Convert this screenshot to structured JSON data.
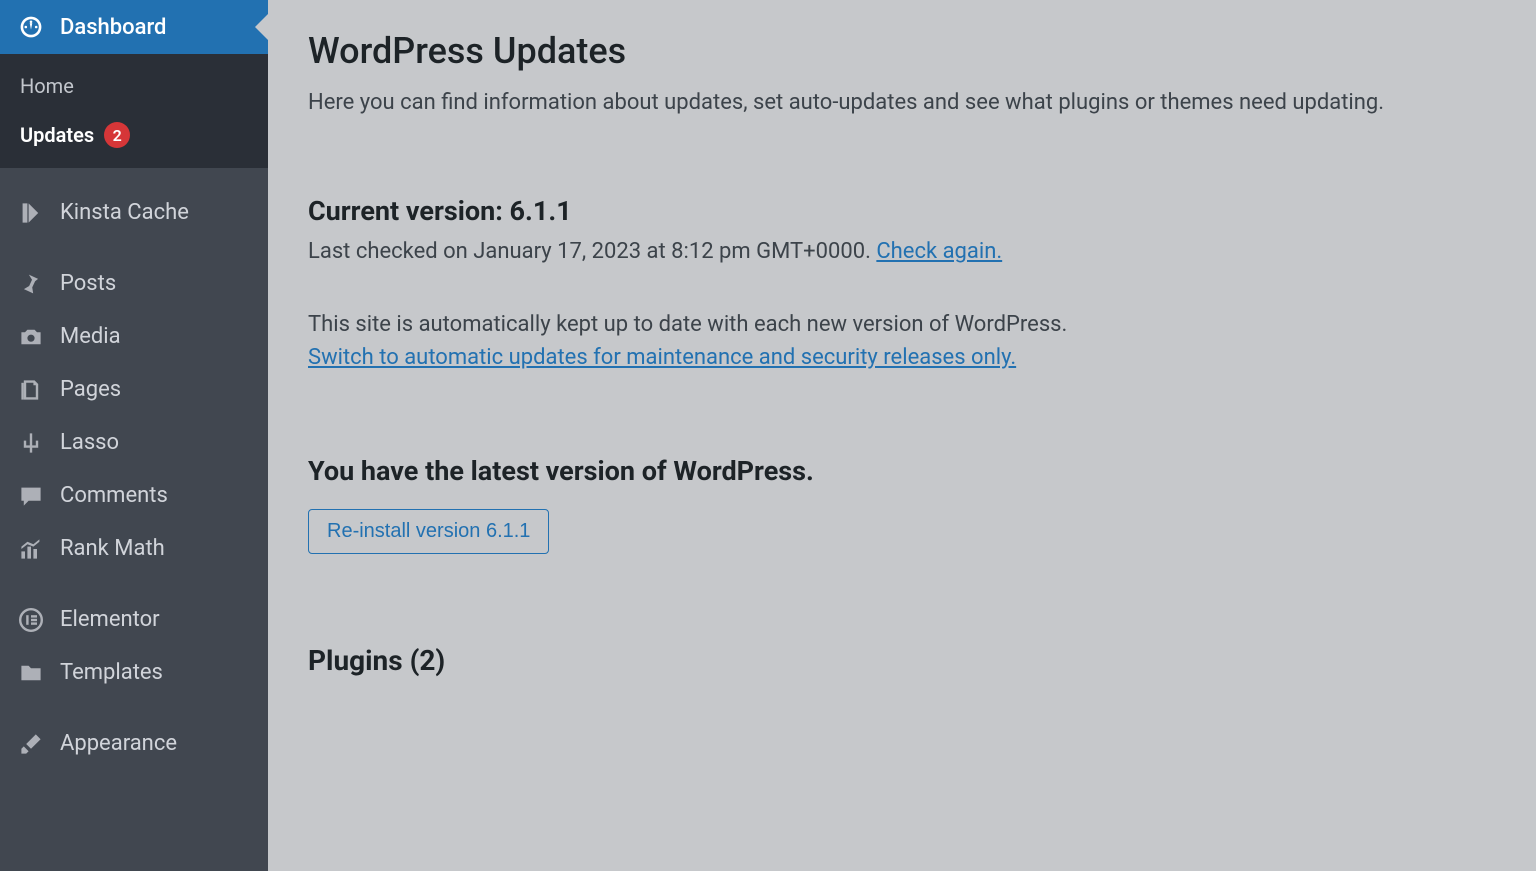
{
  "sidebar": {
    "dashboard": {
      "label": "Dashboard"
    },
    "submenu": {
      "home": "Home",
      "updates": "Updates",
      "updates_badge": "2"
    },
    "items": [
      {
        "label": "Kinsta Cache",
        "icon": "kinsta-icon"
      },
      {
        "label": "Posts",
        "icon": "pin-icon"
      },
      {
        "label": "Media",
        "icon": "camera-icon"
      },
      {
        "label": "Pages",
        "icon": "page-icon"
      },
      {
        "label": "Lasso",
        "icon": "cactus-icon"
      },
      {
        "label": "Comments",
        "icon": "comment-icon"
      },
      {
        "label": "Rank Math",
        "icon": "chart-icon"
      },
      {
        "label": "Elementor",
        "icon": "elementor-icon"
      },
      {
        "label": "Templates",
        "icon": "folder-icon"
      },
      {
        "label": "Appearance",
        "icon": "brush-icon"
      }
    ]
  },
  "main": {
    "title": "WordPress Updates",
    "intro": "Here you can find information about updates, set auto-updates and see what plugins or themes need updating.",
    "version_heading": "Current version: 6.1.1",
    "last_checked_prefix": "Last checked on January 17, 2023 at 8:12 pm GMT+0000. ",
    "check_again": "Check again.",
    "auto_msg": "This site is automatically kept up to date with each new version of WordPress.",
    "auto_link": "Switch to automatic updates for maintenance and security releases only.",
    "latest_heading": "You have the latest version of WordPress.",
    "reinstall_button": "Re-install version 6.1.1",
    "plugins_heading": "Plugins (2)"
  }
}
